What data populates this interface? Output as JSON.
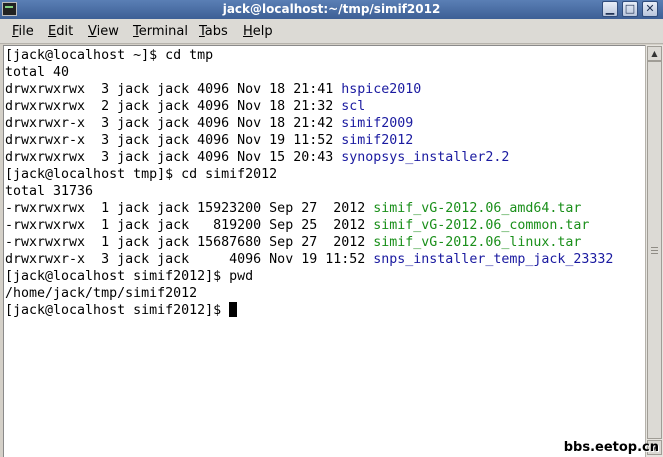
{
  "window": {
    "title": "jack@localhost:~/tmp/simif2012",
    "minimize_glyph": "▁",
    "maximize_glyph": "□",
    "close_glyph": "✕"
  },
  "menu": [
    "File",
    "Edit",
    "View",
    "Terminal",
    "Tabs",
    "Help"
  ],
  "terminal": {
    "lines": [
      [
        {
          "t": "[jack@localhost ~]$ cd tmp",
          "c": "plain"
        }
      ],
      [
        {
          "t": "total 40",
          "c": "plain"
        }
      ],
      [
        {
          "t": "drwxrwxrwx  3 jack jack 4096 Nov 18 21:41 ",
          "c": "plain"
        },
        {
          "t": "hspice2010",
          "c": "dir"
        }
      ],
      [
        {
          "t": "drwxrwxrwx  2 jack jack 4096 Nov 18 21:32 ",
          "c": "plain"
        },
        {
          "t": "scl",
          "c": "dir"
        }
      ],
      [
        {
          "t": "drwxrwxr-x  3 jack jack 4096 Nov 18 21:42 ",
          "c": "plain"
        },
        {
          "t": "simif2009",
          "c": "dir"
        }
      ],
      [
        {
          "t": "drwxrwxr-x  3 jack jack 4096 Nov 19 11:52 ",
          "c": "plain"
        },
        {
          "t": "simif2012",
          "c": "dir"
        }
      ],
      [
        {
          "t": "drwxrwxrwx  3 jack jack 4096 Nov 15 20:43 ",
          "c": "plain"
        },
        {
          "t": "synopsys_installer2.2",
          "c": "dir"
        }
      ],
      [
        {
          "t": "[jack@localhost tmp]$ cd simif2012",
          "c": "plain"
        }
      ],
      [
        {
          "t": "total 31736",
          "c": "plain"
        }
      ],
      [
        {
          "t": "-rwxrwxrwx  1 jack jack 15923200 Sep 27  2012 ",
          "c": "plain"
        },
        {
          "t": "simif_vG-2012.06_amd64.tar",
          "c": "file"
        }
      ],
      [
        {
          "t": "-rwxrwxrwx  1 jack jack   819200 Sep 25  2012 ",
          "c": "plain"
        },
        {
          "t": "simif_vG-2012.06_common.tar",
          "c": "file"
        }
      ],
      [
        {
          "t": "-rwxrwxrwx  1 jack jack 15687680 Sep 27  2012 ",
          "c": "plain"
        },
        {
          "t": "simif_vG-2012.06_linux.tar",
          "c": "file"
        }
      ],
      [
        {
          "t": "drwxrwxr-x  3 jack jack     4096 Nov 19 11:52 ",
          "c": "plain"
        },
        {
          "t": "snps_installer_temp_jack_23332",
          "c": "dir"
        }
      ],
      [
        {
          "t": "[jack@localhost simif2012]$ pwd",
          "c": "plain"
        }
      ],
      [
        {
          "t": "/home/jack/tmp/simif2012",
          "c": "plain"
        }
      ],
      [
        {
          "t": "[jack@localhost simif2012]$ ",
          "c": "plain"
        },
        {
          "t": "",
          "c": "cursor"
        }
      ]
    ]
  },
  "scrollbar": {
    "up_glyph": "▲",
    "down_glyph": "▼"
  },
  "watermark": "bbs.eetop.cn",
  "colors": {
    "directory": "#1a1aa0",
    "tar_file": "#1a8f1a",
    "titlebar": "#3d5f95"
  }
}
